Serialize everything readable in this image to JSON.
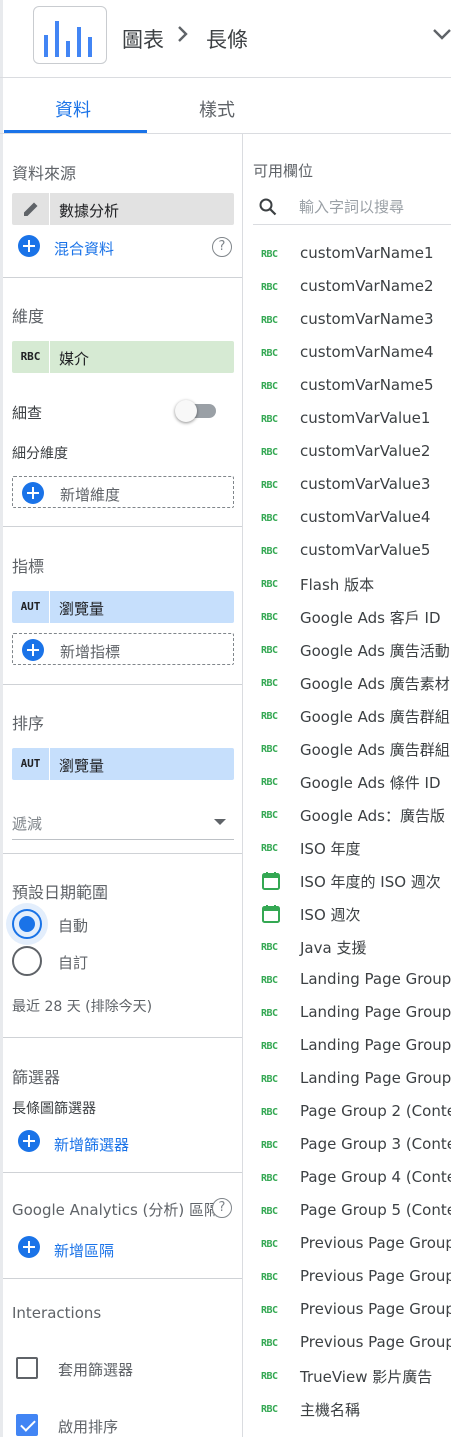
{
  "header": {
    "breadcrumb_chart": "圖表",
    "breadcrumb_type": "長條",
    "logo_icon": "bar-chart-icon"
  },
  "tabs": [
    {
      "label": "資料",
      "active": true
    },
    {
      "label": "樣式",
      "active": false
    }
  ],
  "data_source": {
    "title": "資料來源",
    "source_name": "數據分析",
    "blend_label": "混合資料",
    "help_glyph": "?"
  },
  "dimension": {
    "title": "維度",
    "chip_type": "RBC",
    "chip_label": "媒介",
    "drilldown_label": "細查",
    "drilldown_on": false,
    "breakdown_label": "細分維度",
    "add_label": "新增維度"
  },
  "metric": {
    "title": "指標",
    "chip_type": "AUT",
    "chip_label": "瀏覽量",
    "add_label": "新增指標"
  },
  "sort": {
    "title": "排序",
    "chip_type": "AUT",
    "chip_label": "瀏覽量",
    "order_value": "遞減"
  },
  "date_range": {
    "title": "預設日期範圍",
    "option_auto": "自動",
    "option_custom": "自訂",
    "selected": "自動",
    "hint": "最近 28 天 (排除今天)"
  },
  "filters": {
    "title": "篩選器",
    "subtitle": "長條圖篩選器",
    "add_label": "新增篩選器"
  },
  "segments": {
    "title": "Google Analytics (分析) 區隔",
    "add_label": "新增區隔",
    "help_glyph": "?"
  },
  "interactions": {
    "title": "Interactions",
    "apply_filter_label": "套用篩選器",
    "apply_filter_checked": false,
    "enable_sort_label": "啟用排序",
    "enable_sort_checked": true
  },
  "available_fields": {
    "title": "可用欄位",
    "search_placeholder": "輸入字詞以搜尋",
    "fields": [
      {
        "type": "RBC",
        "label": "customVarName1"
      },
      {
        "type": "RBC",
        "label": "customVarName2"
      },
      {
        "type": "RBC",
        "label": "customVarName3"
      },
      {
        "type": "RBC",
        "label": "customVarName4"
      },
      {
        "type": "RBC",
        "label": "customVarName5"
      },
      {
        "type": "RBC",
        "label": "customVarValue1"
      },
      {
        "type": "RBC",
        "label": "customVarValue2"
      },
      {
        "type": "RBC",
        "label": "customVarValue3"
      },
      {
        "type": "RBC",
        "label": "customVarValue4"
      },
      {
        "type": "RBC",
        "label": "customVarValue5"
      },
      {
        "type": "RBC",
        "label": "Flash 版本"
      },
      {
        "type": "RBC",
        "label": "Google Ads 客戶 ID"
      },
      {
        "type": "RBC",
        "label": "Google Ads 廣告活動"
      },
      {
        "type": "RBC",
        "label": "Google Ads 廣告素材"
      },
      {
        "type": "RBC",
        "label": "Google Ads 廣告群組"
      },
      {
        "type": "RBC",
        "label": "Google Ads 廣告群組"
      },
      {
        "type": "RBC",
        "label": "Google Ads 條件 ID"
      },
      {
        "type": "RBC",
        "label": "Google Ads：廣告版"
      },
      {
        "type": "RBC",
        "label": "ISO 年度"
      },
      {
        "type": "calendar-icon",
        "label": "ISO 年度的 ISO 週次"
      },
      {
        "type": "calendar-icon",
        "label": "ISO 週次"
      },
      {
        "type": "RBC",
        "label": "Java 支援"
      },
      {
        "type": "RBC",
        "label": "Landing Page Group"
      },
      {
        "type": "RBC",
        "label": "Landing Page Group"
      },
      {
        "type": "RBC",
        "label": "Landing Page Group"
      },
      {
        "type": "RBC",
        "label": "Landing Page Group"
      },
      {
        "type": "RBC",
        "label": "Page Group 2 (Conte"
      },
      {
        "type": "RBC",
        "label": "Page Group 3 (Conte"
      },
      {
        "type": "RBC",
        "label": "Page Group 4 (Conte"
      },
      {
        "type": "RBC",
        "label": "Page Group 5 (Conte"
      },
      {
        "type": "RBC",
        "label": "Previous Page Group"
      },
      {
        "type": "RBC",
        "label": "Previous Page Group"
      },
      {
        "type": "RBC",
        "label": "Previous Page Group"
      },
      {
        "type": "RBC",
        "label": "Previous Page Group"
      },
      {
        "type": "RBC",
        "label": "TrueView 影片廣告"
      },
      {
        "type": "RBC",
        "label": "主機名稱"
      }
    ]
  },
  "colors": {
    "accent": "#1a73e8",
    "dimension_green": "#34a853",
    "dimension_chip_bg": "#d6ead3",
    "metric_chip_bg": "#c6dffc"
  }
}
